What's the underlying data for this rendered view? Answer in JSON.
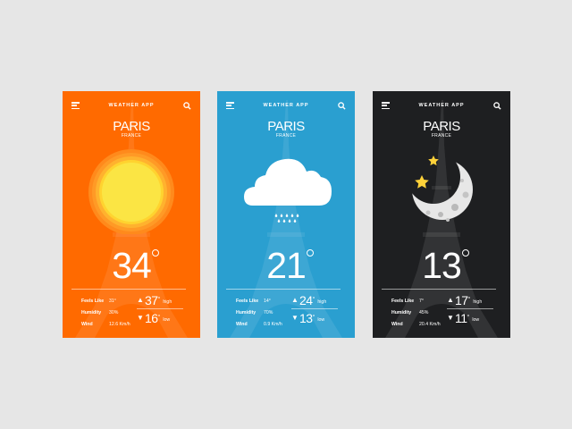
{
  "cards": [
    {
      "theme": "sunny",
      "background": "#ff6a00",
      "header": {
        "title": "WEATHER APP",
        "menu_icon": "hamburger-menu-icon",
        "search_icon": "search-icon"
      },
      "city": "PARIS",
      "country": "FRANCE",
      "condition_icon": "sun-icon",
      "temperature": "34",
      "details": [
        {
          "label": "Feels Like",
          "value": "31°"
        },
        {
          "label": "Humidity",
          "value": "30%"
        },
        {
          "label": "Wind",
          "value": "12.6 Km/h"
        }
      ],
      "high": {
        "value": "37",
        "label": "high"
      },
      "low": {
        "value": "16",
        "label": "low"
      }
    },
    {
      "theme": "rainy",
      "background": "#2a9fd0",
      "header": {
        "title": "WEATHER APP",
        "menu_icon": "hamburger-menu-icon",
        "search_icon": "search-icon"
      },
      "city": "PARIS",
      "country": "FRANCE",
      "condition_icon": "rain-cloud-icon",
      "temperature": "21",
      "details": [
        {
          "label": "Feels Like",
          "value": "14°"
        },
        {
          "label": "Humidity",
          "value": "70%"
        },
        {
          "label": "Wind",
          "value": "0.9 Km/h"
        }
      ],
      "high": {
        "value": "24",
        "label": "high"
      },
      "low": {
        "value": "13",
        "label": "low"
      }
    },
    {
      "theme": "night",
      "background": "#1e1f21",
      "header": {
        "title": "WEATHER APP",
        "menu_icon": "hamburger-menu-icon",
        "search_icon": "search-icon"
      },
      "city": "PARIS",
      "country": "FRANCE",
      "condition_icon": "moon-stars-icon",
      "temperature": "13",
      "details": [
        {
          "label": "Feels Like",
          "value": "7°"
        },
        {
          "label": "Humidity",
          "value": "45%"
        },
        {
          "label": "Wind",
          "value": "20.4 Km/h"
        }
      ],
      "high": {
        "value": "17",
        "label": "high"
      },
      "low": {
        "value": "11",
        "label": "low"
      }
    }
  ]
}
